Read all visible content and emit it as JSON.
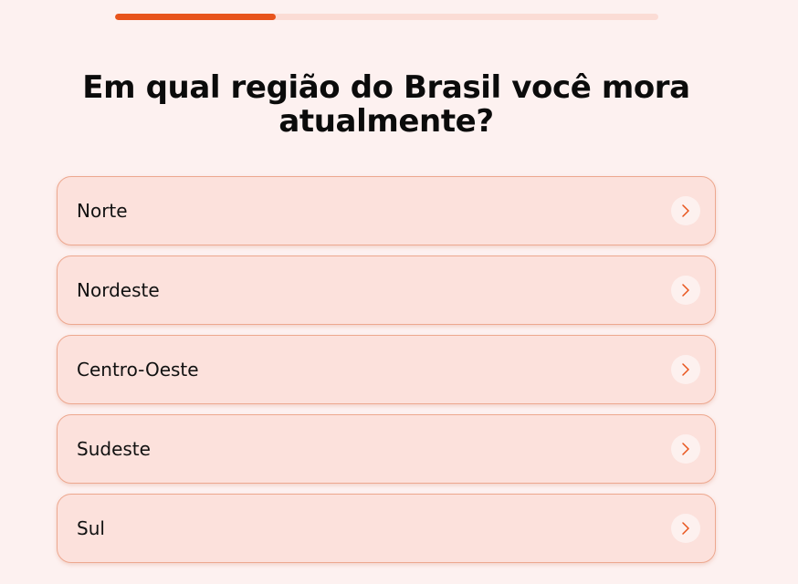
{
  "progress": {
    "value": 0.295,
    "fill_color": "#e8541c",
    "track_color": "#fbdcd5"
  },
  "question": "Em qual região do Brasil você mora atualmente?",
  "options": [
    {
      "label": "Norte",
      "icon": "chevron-right-icon"
    },
    {
      "label": "Nordeste",
      "icon": "chevron-right-icon"
    },
    {
      "label": "Centro-Oeste",
      "icon": "chevron-right-icon"
    },
    {
      "label": "Sudeste",
      "icon": "chevron-right-icon"
    },
    {
      "label": "Sul",
      "icon": "chevron-right-icon"
    }
  ],
  "colors": {
    "background": "#fdf1f0",
    "option_background": "#fce1dc",
    "option_border": "#eda88f",
    "accent": "#e8541c"
  }
}
